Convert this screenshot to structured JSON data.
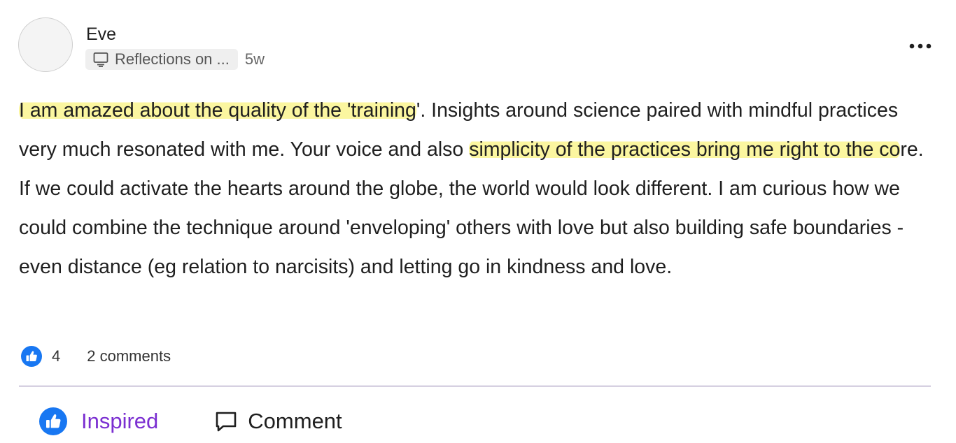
{
  "author": {
    "name": "Eve"
  },
  "post_meta": {
    "space": "Reflections on ...",
    "space_icon": "monitor-icon",
    "time_ago": "5w"
  },
  "menu": {
    "icon": "more-horizontal-icon"
  },
  "body": {
    "highlight_color": "#fbf6a0",
    "segments": {
      "s1": "I am amazed about the quality of the 'training",
      "s2": "'. Insights around science paired with mindful practices very much resonated with me. Your voice and also ",
      "s3": "simplicity of the practices bring me right to the co",
      "s4": "re. If we could activate the hearts around the globe, the world would look different. I am curious how we could combine the technique around 'enveloping' others with love but also building safe boundaries - even distance (eg relation to narcisits) and letting go in kindness and love."
    }
  },
  "stats": {
    "likes": "4",
    "comments": "2 comments",
    "like_icon_color": "#1877f2"
  },
  "actions": {
    "inspired_label": "Inspired",
    "inspired_color": "#7b2fd1",
    "comment_label": "Comment"
  }
}
